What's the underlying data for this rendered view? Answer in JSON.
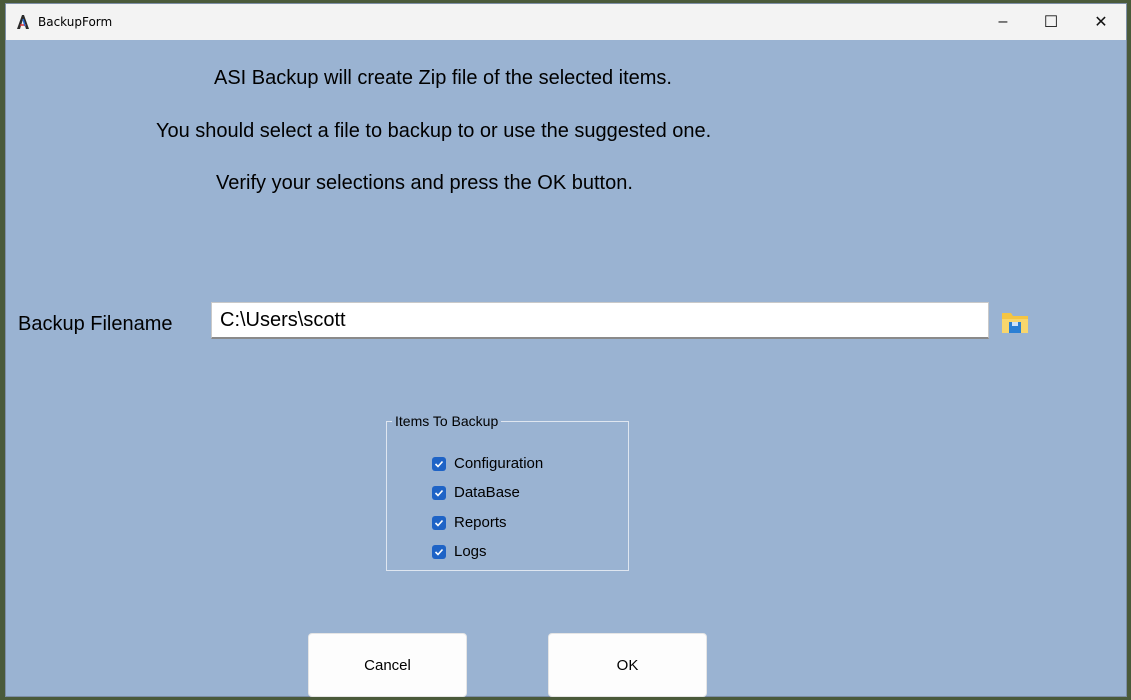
{
  "window": {
    "title": "BackupForm",
    "controls": {
      "minimize": "–",
      "maximize": "☐",
      "close": "✕"
    }
  },
  "instructions": {
    "line1": "ASI Backup will create Zip file of the selected items.",
    "line2": "You should select a file to backup to or use the suggested one.",
    "line3": "Verify your selections and press the OK button."
  },
  "filename": {
    "label": "Backup Filename",
    "value": "C:\\Users\\scott"
  },
  "items_group": {
    "title": "Items To Backup",
    "items": [
      {
        "label": "Configuration",
        "checked": true
      },
      {
        "label": "DataBase",
        "checked": true
      },
      {
        "label": "Reports",
        "checked": true
      },
      {
        "label": "Logs",
        "checked": true
      }
    ]
  },
  "buttons": {
    "cancel": "Cancel",
    "ok": "OK"
  },
  "colors": {
    "form_background": "#9ab3d2",
    "checkbox": "#1e63c6",
    "titlebar": "#f3f3f3"
  },
  "icons": {
    "app": "asi-logo-icon",
    "browse": "folder-icon"
  }
}
